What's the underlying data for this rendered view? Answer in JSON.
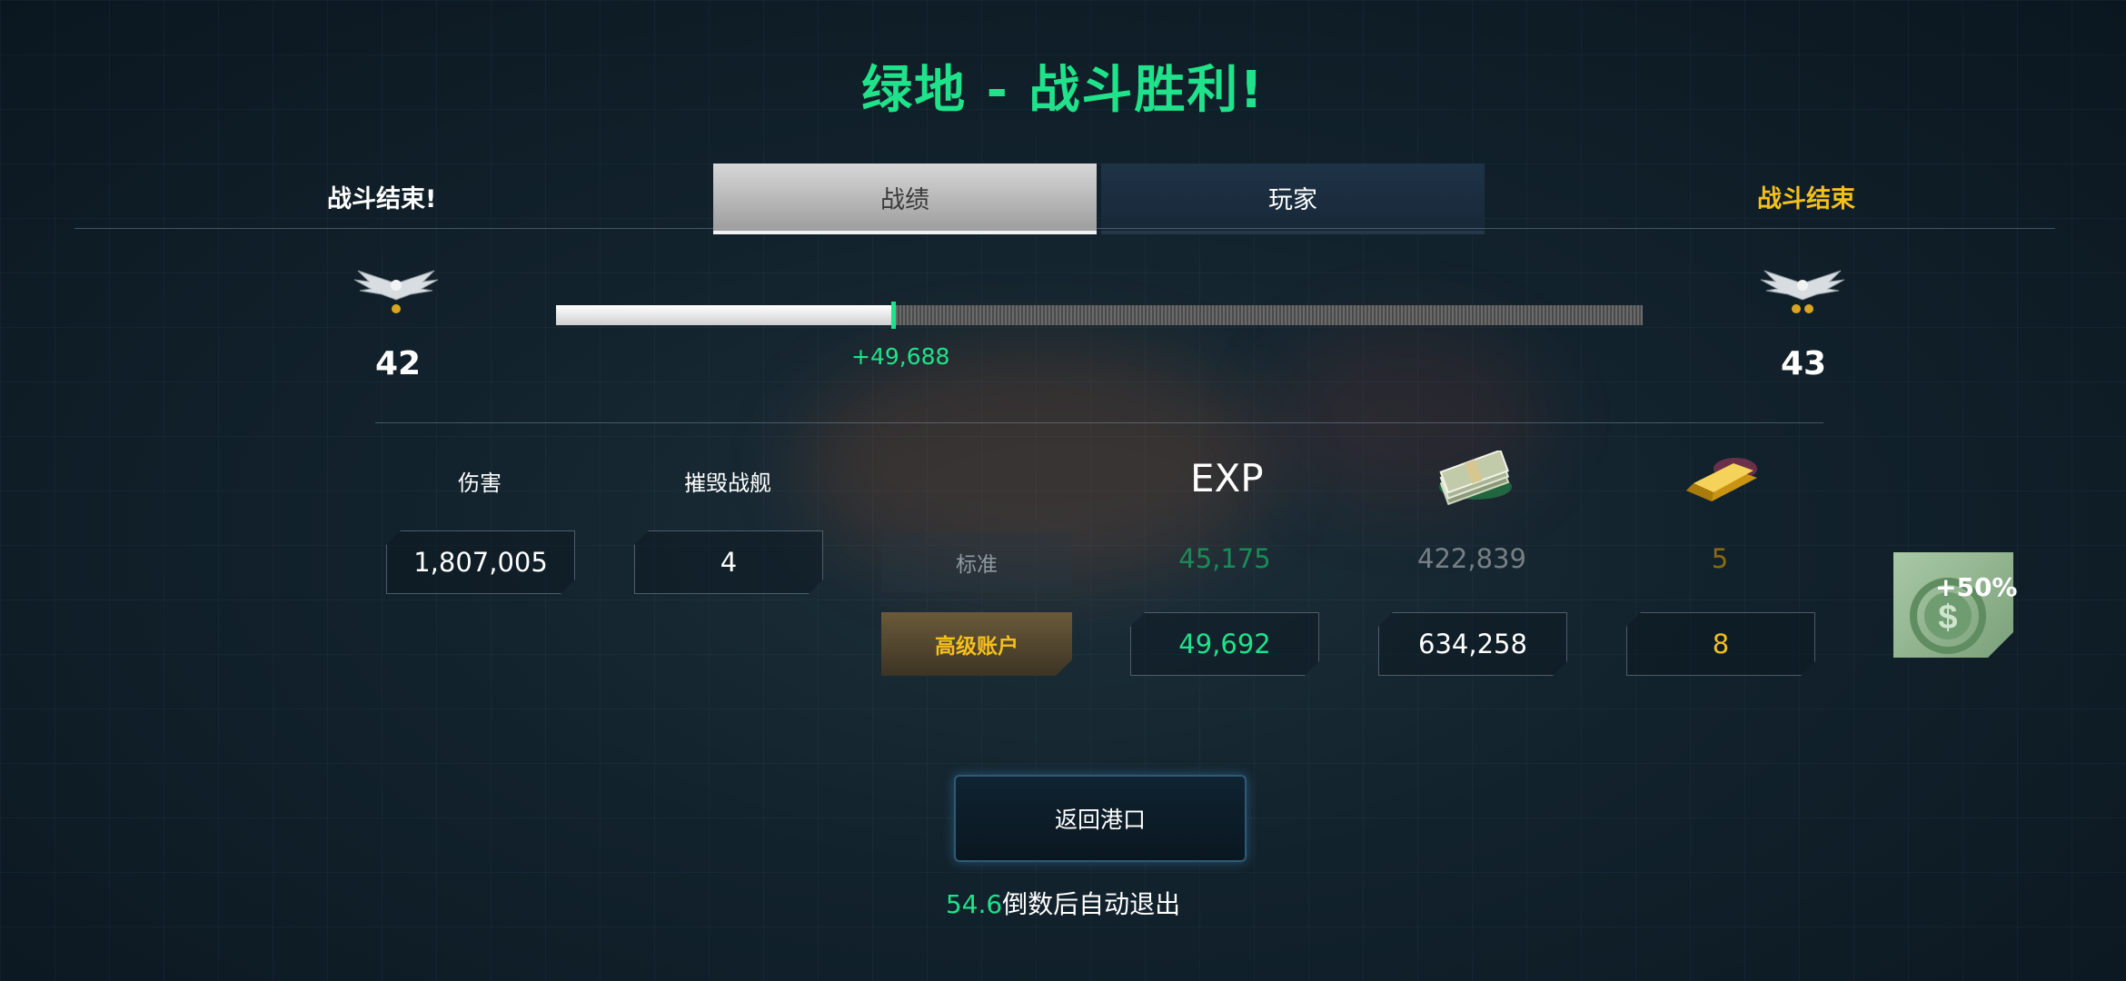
{
  "header": {
    "title": "绿地 - 战斗胜利!"
  },
  "status": {
    "left": "战斗结束!",
    "right": "战斗结束"
  },
  "tabs": [
    {
      "label": "战绩",
      "active": true
    },
    {
      "label": "玩家",
      "active": false
    }
  ],
  "rank": {
    "current_level": "42",
    "next_level": "43",
    "xp_gain": "+49,688",
    "progress_fraction": 0.31
  },
  "stats": {
    "damage_label": "伤害",
    "damage_value": "1,807,005",
    "kills_label": "摧毁战舰",
    "kills_value": "4"
  },
  "rewards": {
    "exp_label": "EXP",
    "standard_label": "标准",
    "standard": {
      "exp": "45,175",
      "credits": "422,839",
      "gold": "5"
    },
    "premium_label": "高级账户",
    "premium": {
      "exp": "49,692",
      "credits": "634,258",
      "gold": "8"
    },
    "bonus": "+50%"
  },
  "actions": {
    "return_label": "返回港口"
  },
  "countdown": {
    "seconds": "54.6",
    "text": "倒数后自动退出"
  },
  "colors": {
    "accent_green": "#1fe28a",
    "gold": "#f4c01c"
  },
  "icons": {
    "rank": "eagle-rank-icon",
    "credits": "cash-stack-icon",
    "gold": "gold-bar-icon",
    "bonus": "dollar-coin-icon"
  }
}
